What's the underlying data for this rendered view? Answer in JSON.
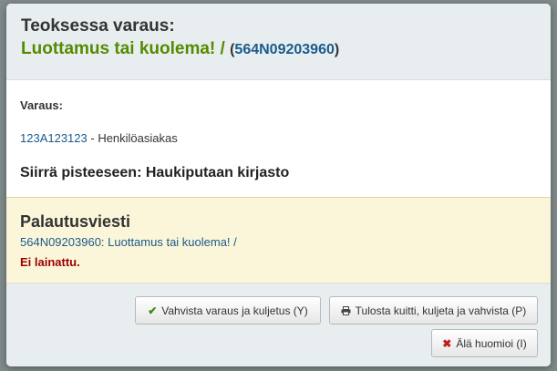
{
  "header": {
    "prefix": "Teoksessa varaus:",
    "title": "Luottamus tai kuolema! /",
    "open_paren": "(",
    "barcode": "564N09203960",
    "close_paren": ")"
  },
  "reservation": {
    "label": "Varaus:",
    "patron_card": "123A123123",
    "patron_sep": " - ",
    "patron_category": "Henkilöasiakas",
    "transfer_text": "Siirrä pisteeseen: Haukiputaan kirjasto"
  },
  "return_message": {
    "title": "Palautusviesti",
    "item_link": "564N09203960: Luottamus tai kuolema! /",
    "warning": "Ei lainattu."
  },
  "footer": {
    "confirm_label": "Vahvista varaus ja kuljetus (Y)",
    "print_label": "Tulosta kuitti, kuljeta ja vahvista (P)",
    "ignore_label": "Älä huomioi (I)"
  },
  "icons": {
    "confirm": "check-icon",
    "print": "print-icon",
    "ignore": "close-icon"
  },
  "colors": {
    "title_green": "#558a00",
    "link_blue": "#1a5a8c",
    "warning_red": "#990000",
    "alert_bg": "#fbf6d9",
    "header_bg": "#e8eef0"
  }
}
